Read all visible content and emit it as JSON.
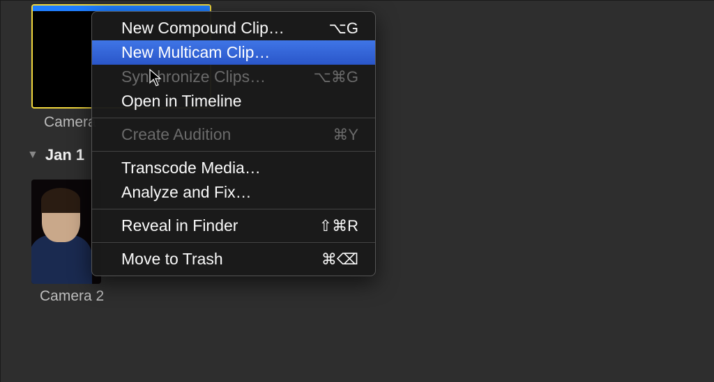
{
  "clips": {
    "clip1_label": "Camera",
    "clip2_label": "Camera 2"
  },
  "date_row": {
    "label": "Jan 1"
  },
  "context_menu": {
    "items": [
      {
        "label": "New Compound Clip…",
        "shortcut": "⌥G",
        "disabled": false,
        "highlighted": false
      },
      {
        "label": "New Multicam Clip…",
        "shortcut": "",
        "disabled": false,
        "highlighted": true
      },
      {
        "label": "Synchronize Clips…",
        "shortcut": "⌥⌘G",
        "disabled": true,
        "highlighted": false
      },
      {
        "label": "Open in Timeline",
        "shortcut": "",
        "disabled": false,
        "highlighted": false
      },
      {
        "sep": true
      },
      {
        "label": "Create Audition",
        "shortcut": "⌘Y",
        "disabled": true,
        "highlighted": false
      },
      {
        "sep": true
      },
      {
        "label": "Transcode Media…",
        "shortcut": "",
        "disabled": false,
        "highlighted": false
      },
      {
        "label": "Analyze and Fix…",
        "shortcut": "",
        "disabled": false,
        "highlighted": false
      },
      {
        "sep": true
      },
      {
        "label": "Reveal in Finder",
        "shortcut": "⇧⌘R",
        "disabled": false,
        "highlighted": false
      },
      {
        "sep": true
      },
      {
        "label": "Move to Trash",
        "shortcut": "⌘⌫",
        "disabled": false,
        "highlighted": false
      }
    ]
  }
}
